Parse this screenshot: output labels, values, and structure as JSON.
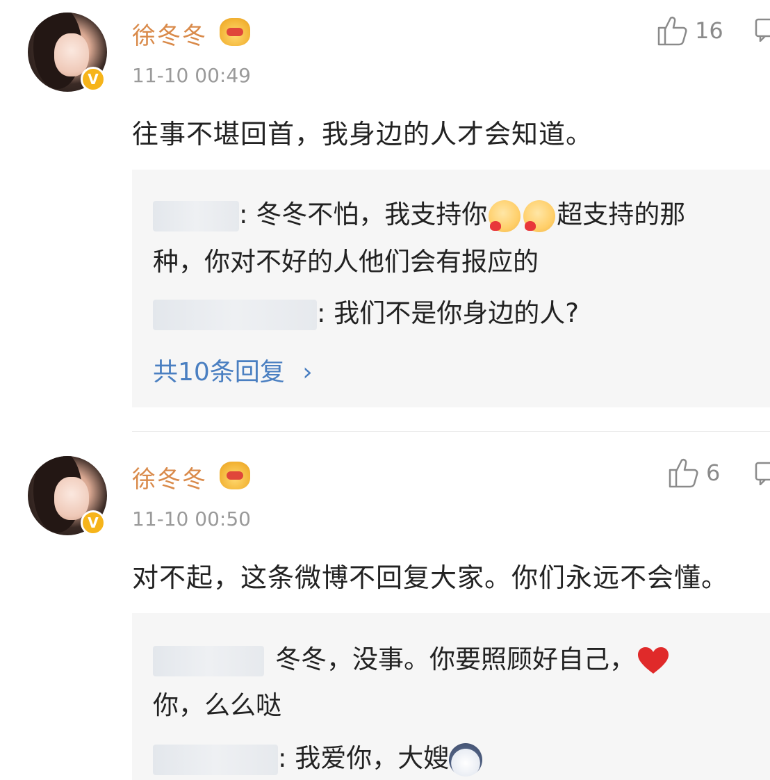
{
  "comments": [
    {
      "username": "徐冬冬",
      "timestamp": "11-10 00:49",
      "likes": "16",
      "text": "往事不堪回首，我身边的人才会知道。",
      "replies": [
        {
          "text_a": ": 冬冬不怕，我支持你",
          "text_b": "超支持的那",
          "text_c": "种，你对不好的人他们会有报应的"
        },
        {
          "text_a": ": 我们不是你身边的人?"
        }
      ],
      "more_replies": "共10条回复",
      "more_chevron": "›"
    },
    {
      "username": "徐冬冬",
      "timestamp": "11-10 00:50",
      "likes": "6",
      "text": "对不起，这条微博不回复大家。你们永远不会懂。",
      "replies": [
        {
          "text_a": "冬冬，没事。你要照顾好自己，",
          "text_c": "你，么么哒"
        },
        {
          "text_a": ": 我爱你，大嫂"
        }
      ]
    }
  ],
  "icons": {
    "verified_badge": "V",
    "like_icon": "thumbs-up-icon",
    "reply_icon": "comment-icon",
    "vip_icon": "crown-emoji-icon"
  },
  "colors": {
    "username": "#d98a4a",
    "link": "#4a7fc1",
    "badge": "#f6b41a",
    "reply_bg": "#f6f6f6"
  }
}
